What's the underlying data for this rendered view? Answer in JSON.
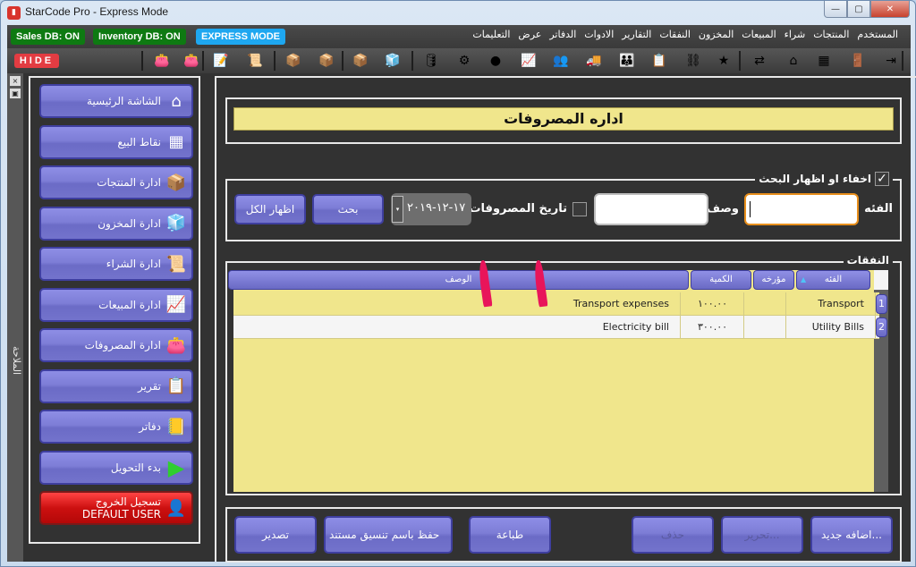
{
  "window": {
    "title": "StarCode Pro - Express Mode",
    "controls": {
      "minimize": "—",
      "maximize": "▢",
      "close": "✕"
    }
  },
  "status": {
    "sales_db": "Sales DB: ON",
    "inventory_db": "Inventory DB: ON",
    "mode": "EXPRESS MODE",
    "colors": {
      "db_on": "#0e7a12",
      "mode": "#1ea7f0"
    }
  },
  "menu": [
    "المستخدم",
    "المنتجات",
    "شراء",
    "المبيعات",
    "المخزون",
    "النفقات",
    "التقارير",
    "الادوات",
    "الدفاتر",
    "عرض",
    "التعليمات"
  ],
  "toolbar": {
    "hide_label": "HIDE",
    "icons": [
      {
        "name": "add-expense-icon",
        "glyph": "👛"
      },
      {
        "name": "wallet-icon",
        "glyph": "👛"
      },
      {
        "name": "invoice-edit-icon",
        "glyph": "📝"
      },
      {
        "name": "purchase-list-icon",
        "glyph": "📜"
      },
      {
        "name": "open-box-icon",
        "glyph": "📦"
      },
      {
        "name": "products-box-icon",
        "glyph": "📦"
      },
      {
        "name": "boxes-stack-icon",
        "glyph": "📦"
      },
      {
        "name": "inventory-cubes-icon",
        "glyph": "🧊"
      },
      {
        "name": "database-icon",
        "glyph": "🛢"
      },
      {
        "name": "settings-gear-icon",
        "glyph": "⚙"
      },
      {
        "name": "green-circle-icon",
        "glyph": "●"
      },
      {
        "name": "sales-chart-icon",
        "glyph": "📈"
      },
      {
        "name": "users-red-icon",
        "glyph": "👥"
      },
      {
        "name": "delivery-truck-icon",
        "glyph": "🚚"
      },
      {
        "name": "customers-icon",
        "glyph": "👪"
      },
      {
        "name": "report-form-icon",
        "glyph": "📋"
      },
      {
        "name": "hierarchy-icon",
        "glyph": "⛓"
      },
      {
        "name": "star-icon",
        "glyph": "★"
      },
      {
        "name": "transfer-arrows-icon",
        "glyph": "⇄"
      },
      {
        "name": "home-icon",
        "glyph": "⌂"
      },
      {
        "name": "pos-terminal-icon",
        "glyph": "▦"
      },
      {
        "name": "logout-door-icon",
        "glyph": "🚪"
      },
      {
        "name": "exit-icon",
        "glyph": "⇥"
      }
    ]
  },
  "side_panel": {
    "label": "الملاحة",
    "close": "×",
    "pin": "▣"
  },
  "sidebar": {
    "items": [
      {
        "label": "الشاشة الرئيسية",
        "icon": "⌂"
      },
      {
        "label": "نقاط البيع",
        "icon": "▦"
      },
      {
        "label": "ادارة المنتجات",
        "icon": "📦"
      },
      {
        "label": "ادارة المخزون",
        "icon": "🧊"
      },
      {
        "label": "ادارة الشراء",
        "icon": "📜"
      },
      {
        "label": "ادارة المبيعات",
        "icon": "📈"
      },
      {
        "label": "ادارة المصروفات",
        "icon": "👛"
      },
      {
        "label": "تقرير",
        "icon": "📋"
      },
      {
        "label": "دفاتر",
        "icon": "📒"
      },
      {
        "label": "بدء التحويل",
        "icon": "▶"
      }
    ],
    "logout": {
      "label": "تسجيل الخروج",
      "user": "DEFAULT USER",
      "icon": "👤"
    }
  },
  "main": {
    "page_title": "اداره المصروفات",
    "search": {
      "legend": "اخفاء او اظهار البحث",
      "legend_checked": true,
      "category_label": "الفئه",
      "category_value": "",
      "desc_label": "وصف",
      "desc_value": "",
      "date_label": "تاريخ المصروفات",
      "date_checked": false,
      "date_value": "١٧-١٢-٢٠١٩",
      "search_button": "بحث",
      "show_all_button": "اظهار الكل"
    },
    "grid": {
      "legend": "النفقات",
      "columns": [
        "الفئه",
        "مؤرخه",
        "الكمية",
        "الوصف"
      ],
      "sorted_column": "الفئه",
      "rows": [
        {
          "num": "1",
          "category": "Transport",
          "date": "",
          "amount": "١٠٠.٠٠",
          "description": "Transport expenses"
        },
        {
          "num": "2",
          "category": "Utility Bills",
          "date": "",
          "amount": "٣٠٠.٠٠",
          "description": "Electricity bill"
        }
      ]
    },
    "actions": {
      "add": "اضافه جديد...",
      "edit": "تحرير...",
      "delete": "حذف",
      "print": "طباعة",
      "save_as": "حفظ باسم تنسيق مستند",
      "export": "تصدير"
    }
  }
}
